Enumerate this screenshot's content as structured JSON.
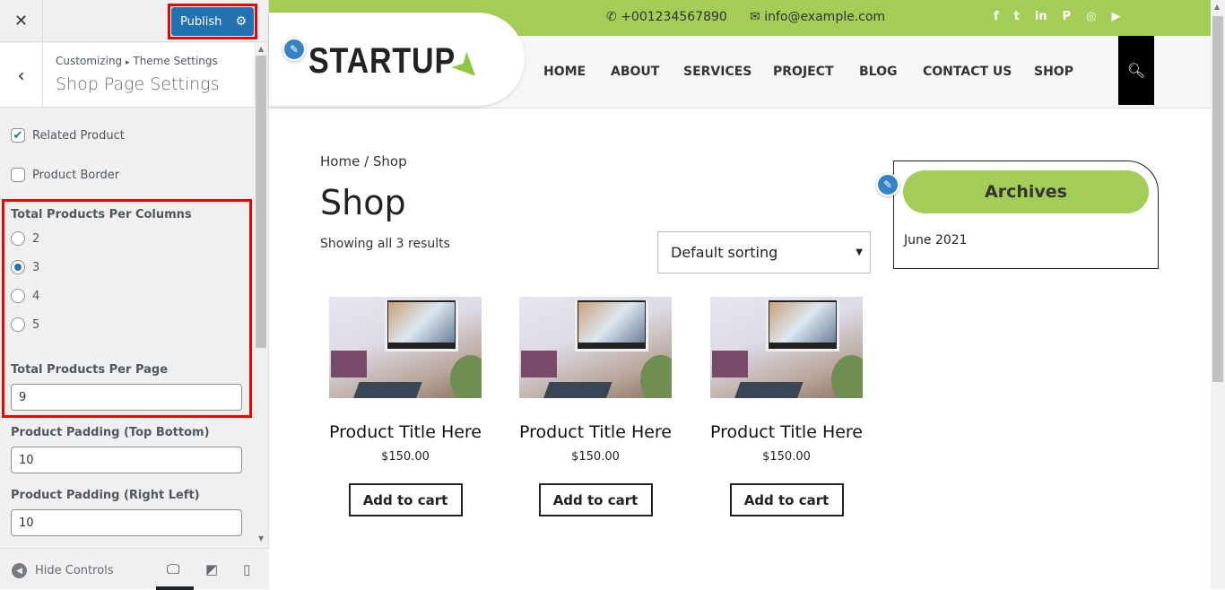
{
  "customizer": {
    "close_icon": "close-icon",
    "publish_label": "Publish",
    "breadcrumb": [
      "Customizing",
      "Theme Settings"
    ],
    "breadcrumb_sep": "▸",
    "section_title": "Shop Page Settings",
    "related_product": {
      "label": "Related Product",
      "checked": true
    },
    "product_border": {
      "label": "Product Border",
      "checked": false
    },
    "columns": {
      "label": "Total Products Per Columns",
      "options": [
        "2",
        "3",
        "4",
        "5"
      ],
      "selected": "3"
    },
    "per_page": {
      "label": "Total Products Per Page",
      "value": "9"
    },
    "padding_tb": {
      "label": "Product Padding (Top Bottom)",
      "value": "10"
    },
    "padding_rl": {
      "label": "Product Padding (Right Left)",
      "value": "10"
    },
    "hide_controls": "Hide Controls",
    "active_device": "desktop",
    "highlight_color": "#ff0000"
  },
  "site": {
    "phone": "+001234567890",
    "email": "info@example.com",
    "social": [
      "facebook",
      "twitter",
      "linkedin",
      "pinterest",
      "instagram",
      "youtube"
    ],
    "logo_text": "STARTUP",
    "nav": [
      "HOME",
      "ABOUT",
      "SERVICES",
      "PROJECT",
      "BLOG",
      "CONTACT US",
      "SHOP"
    ],
    "accent": "#a3cd57",
    "breadcrumb": "Home / Shop",
    "page_title": "Shop",
    "result_count": "Showing all 3 results",
    "sorting": "Default sorting",
    "products": [
      {
        "title": "Product Title Here",
        "price": "$150.00",
        "button": "Add to cart"
      },
      {
        "title": "Product Title Here",
        "price": "$150.00",
        "button": "Add to cart"
      },
      {
        "title": "Product Title Here",
        "price": "$150.00",
        "button": "Add to cart"
      }
    ],
    "archives": {
      "title": "Archives",
      "items": [
        "June 2021"
      ]
    }
  }
}
